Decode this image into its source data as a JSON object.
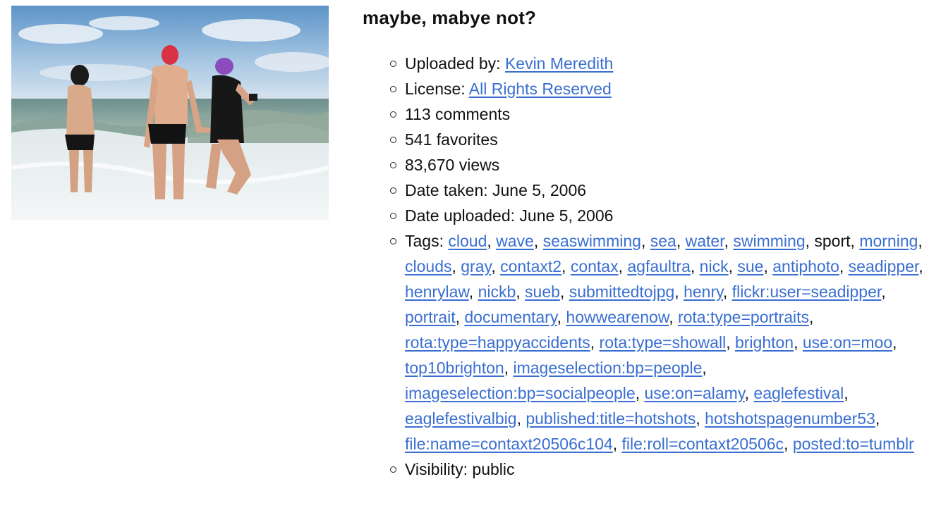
{
  "title": "maybe, mabye not?",
  "photo": {
    "alt": "maybe, mabye not?"
  },
  "meta": {
    "uploaded_by_label": "Uploaded by: ",
    "uploaded_by_name": "Kevin Meredith",
    "license_label": "License: ",
    "license_value": "All Rights Reserved",
    "comments": "113 comments",
    "favorites": "541 favorites",
    "views": "83,670 views",
    "date_taken": "Date taken: June 5, 2006",
    "date_uploaded": "Date uploaded: June 5, 2006",
    "tags_label": "Tags: ",
    "visibility": "Visibility: public"
  },
  "tags": [
    {
      "text": "cloud",
      "link": true
    },
    {
      "text": "wave",
      "link": true
    },
    {
      "text": "seaswimming",
      "link": true
    },
    {
      "text": "sea",
      "link": true
    },
    {
      "text": "water",
      "link": true
    },
    {
      "text": "swimming",
      "link": true
    },
    {
      "text": "sport",
      "link": false
    },
    {
      "text": "morning",
      "link": true
    },
    {
      "text": "clouds",
      "link": true
    },
    {
      "text": "gray",
      "link": true
    },
    {
      "text": "contaxt2",
      "link": true
    },
    {
      "text": "contax",
      "link": true
    },
    {
      "text": "agfaultra",
      "link": true
    },
    {
      "text": "nick",
      "link": true
    },
    {
      "text": "sue",
      "link": true
    },
    {
      "text": "antiphoto",
      "link": true
    },
    {
      "text": "seadipper",
      "link": true
    },
    {
      "text": "henrylaw",
      "link": true
    },
    {
      "text": "nickb",
      "link": true
    },
    {
      "text": "sueb",
      "link": true
    },
    {
      "text": "submittedtojpg",
      "link": true
    },
    {
      "text": "henry",
      "link": true
    },
    {
      "text": "flickr:user=seadipper",
      "link": true
    },
    {
      "text": "portrait",
      "link": true
    },
    {
      "text": "documentary",
      "link": true
    },
    {
      "text": "howwearenow",
      "link": true
    },
    {
      "text": "rota:type=portraits",
      "link": true
    },
    {
      "text": "rota:type=happyaccidents",
      "link": true
    },
    {
      "text": "rota:type=showall",
      "link": true
    },
    {
      "text": "brighton",
      "link": true
    },
    {
      "text": "use:on=moo",
      "link": true
    },
    {
      "text": "top10brighton",
      "link": true
    },
    {
      "text": "imageselection:bp=people",
      "link": true
    },
    {
      "text": "imageselection:bp=socialpeople",
      "link": true
    },
    {
      "text": "use:on=alamy",
      "link": true
    },
    {
      "text": "eaglefestival",
      "link": true
    },
    {
      "text": "eaglefestivalbig",
      "link": true
    },
    {
      "text": "published:title=hotshots",
      "link": true
    },
    {
      "text": "hotshotspagenumber53",
      "link": true
    },
    {
      "text": "file:name=contaxt20506c104",
      "link": true
    },
    {
      "text": "file:roll=contaxt20506c",
      "link": true
    },
    {
      "text": "posted:to=tumblr",
      "link": true
    }
  ],
  "colors": {
    "link": "#3a6fd1",
    "text": "#111111"
  }
}
